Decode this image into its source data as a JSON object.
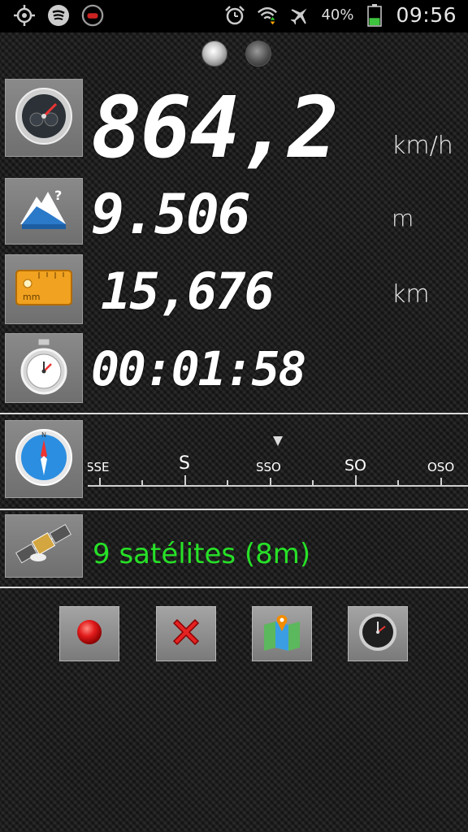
{
  "status_bar": {
    "left_icons": [
      "gps-icon",
      "spotify-icon",
      "gamepad-icon"
    ],
    "right_icons": [
      "alarm-icon",
      "wifi-icon",
      "airplane-icon",
      "battery-icon"
    ],
    "battery_percent": "40%",
    "battery_level": 0.4,
    "time": "09:56"
  },
  "pager": {
    "pages": 2,
    "active_index": 0
  },
  "speed": {
    "value": "864,2",
    "unit": "km/h",
    "icon": "speedometer-icon"
  },
  "altitude": {
    "value": "9.506",
    "unit": "m",
    "icon": "mountain-icon"
  },
  "distance": {
    "value": "15,676",
    "unit": "km",
    "icon": "ruler-icon"
  },
  "timer": {
    "value": "00:01:58",
    "icon": "stopwatch-icon"
  },
  "compass": {
    "icon": "compass-icon",
    "labels": [
      "SSE",
      "S",
      "SSO",
      "SO",
      "OSO"
    ],
    "pointer_icon": "heading-pointer-icon"
  },
  "satellites": {
    "text": "9 satélites (8m)",
    "icon": "satellite-icon",
    "color": "#27e127"
  },
  "toolbar": {
    "buttons": [
      {
        "icon": "record-icon"
      },
      {
        "icon": "delete-icon"
      },
      {
        "icon": "map-icon"
      },
      {
        "icon": "clock-icon"
      }
    ]
  }
}
